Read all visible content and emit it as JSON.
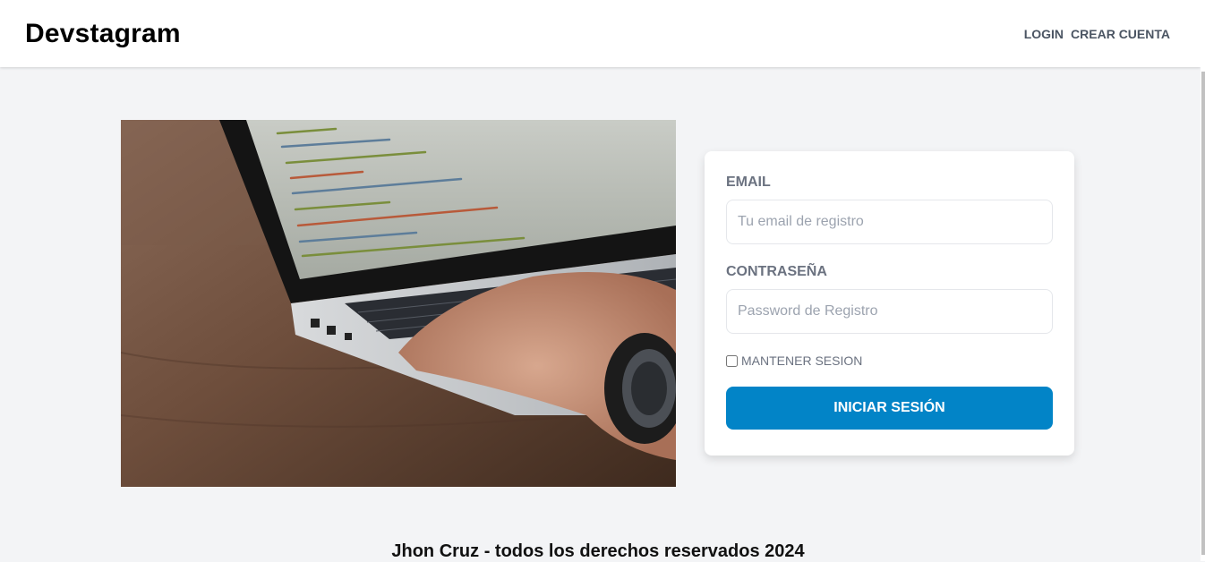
{
  "header": {
    "logo": "Devstagram",
    "nav": {
      "login": "LOGIN",
      "register": "CREAR CUENTA"
    }
  },
  "hero_image": {
    "alt": "laptop-coding-photo"
  },
  "form": {
    "email_label": "EMAIL",
    "email_placeholder": "Tu email de registro",
    "password_label": "CONTRASEÑA",
    "password_placeholder": "Password de Registro",
    "remember_label": "MANTENER SESION",
    "submit_label": "INICIAR SESIÓN"
  },
  "footer": {
    "text": "Jhon Cruz - todos los derechos reservados 2024"
  },
  "colors": {
    "primary": "#0284c7",
    "background": "#f3f4f6"
  }
}
